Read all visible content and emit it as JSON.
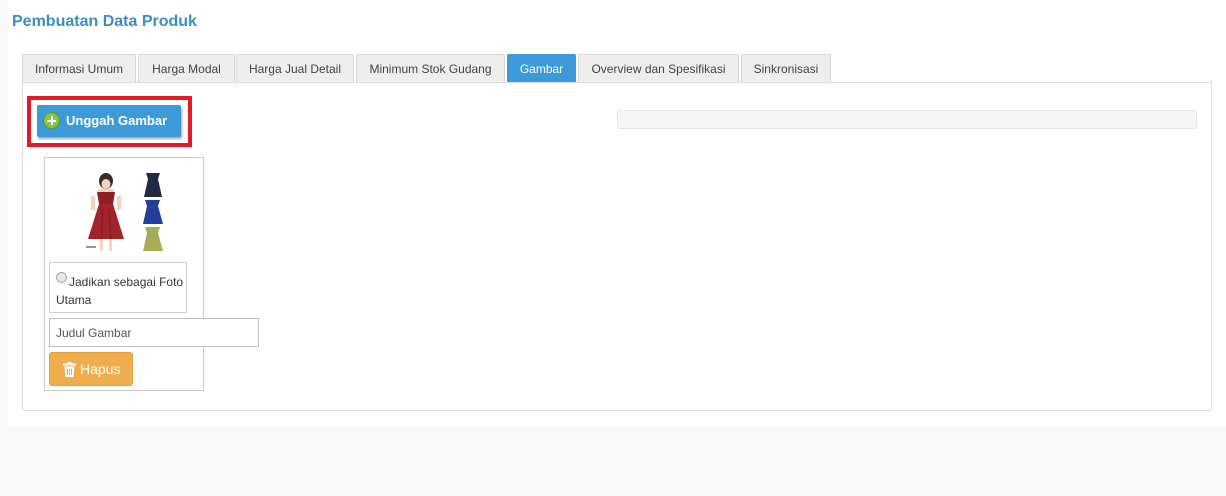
{
  "page": {
    "title": "Pembuatan Data Produk"
  },
  "tabs": [
    {
      "label": "Informasi Umum"
    },
    {
      "label": "Harga Modal"
    },
    {
      "label": "Harga Jual Detail"
    },
    {
      "label": "Minimum Stok Gudang"
    },
    {
      "label": "Gambar"
    },
    {
      "label": "Overview dan Spesifikasi"
    },
    {
      "label": "Sinkronisasi"
    }
  ],
  "active_tab": "Gambar",
  "upload": {
    "label": "Unggah Gambar",
    "icon": "plus-circle-icon"
  },
  "image_card": {
    "thumbnail_icon": "product-dress-image",
    "main_photo_label": "Jadikan sebagai Foto Utama",
    "title_placeholder": "Judul Gambar",
    "delete_label": "Hapus",
    "delete_icon": "trash-icon"
  },
  "colors": {
    "accent": "#3d9ad8",
    "title": "#3b8dc6",
    "highlight": "#e21b26",
    "delete": "#f0ad4e",
    "plus": "#8bc34a"
  }
}
